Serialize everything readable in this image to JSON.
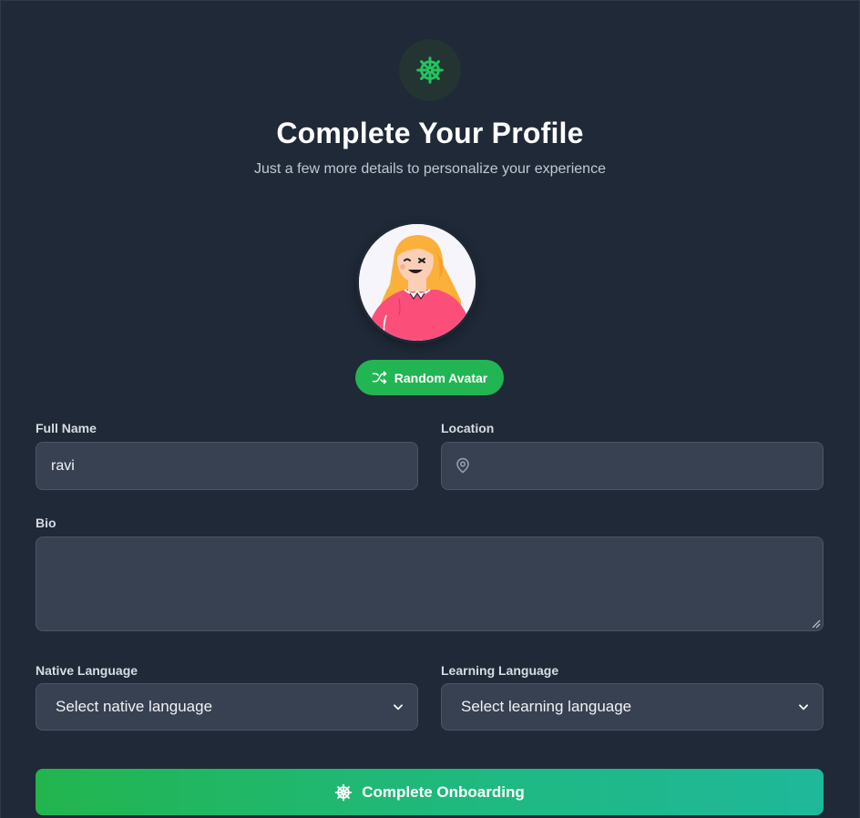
{
  "header": {
    "logo_icon": "ship-wheel-icon",
    "title": "Complete Your Profile",
    "subtitle": "Just a few more details to personalize your experience"
  },
  "avatar": {
    "random_button_label": "Random Avatar",
    "random_icon": "shuffle-icon"
  },
  "form": {
    "full_name": {
      "label": "Full Name",
      "value": "ravi"
    },
    "location": {
      "label": "Location",
      "value": "",
      "icon": "map-pin-icon"
    },
    "bio": {
      "label": "Bio",
      "value": ""
    },
    "native_language": {
      "label": "Native Language",
      "selected": "Select native language"
    },
    "learning_language": {
      "label": "Learning Language",
      "selected": "Select learning language"
    }
  },
  "submit": {
    "label": "Complete Onboarding",
    "icon": "ship-wheel-icon"
  },
  "colors": {
    "background": "#1f2937",
    "field": "#374151",
    "accent": "#22b553",
    "accent_end": "#1fb89a"
  }
}
